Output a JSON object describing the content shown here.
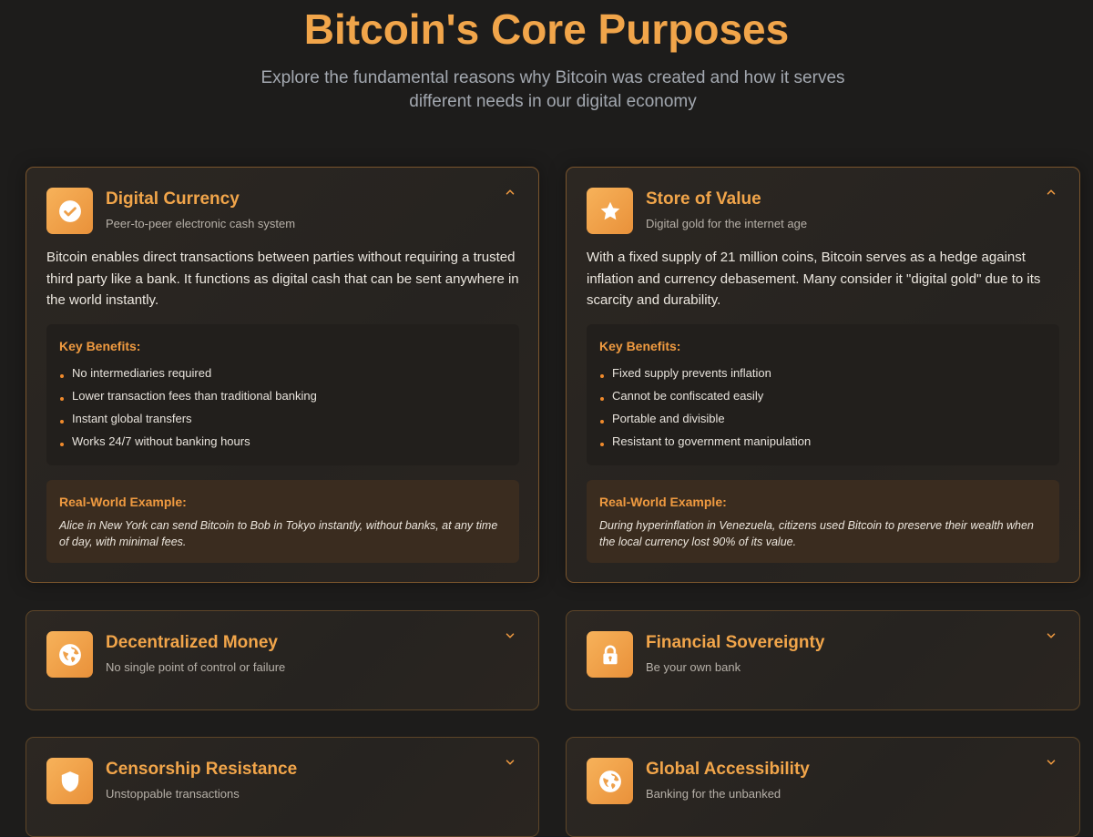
{
  "header": {
    "title": "Bitcoin's Core Purposes",
    "subtitle": "Explore the fundamental reasons why Bitcoin was created and how it serves different needs in our digital economy"
  },
  "colors": {
    "accent": "#f1a54a",
    "background": "#1d1c1b",
    "bullet": "#f08a2c"
  },
  "cards": [
    {
      "title": "Digital Currency",
      "tagline": "Peer-to-peer electronic cash system",
      "icon": "check-circle-icon",
      "expanded": true,
      "description": "Bitcoin enables direct transactions between parties without requiring a trusted third party like a bank. It functions as digital cash that can be sent anywhere in the world instantly.",
      "benefits_label": "Key Benefits:",
      "benefits": [
        "No intermediaries required",
        "Lower transaction fees than traditional banking",
        "Instant global transfers",
        "Works 24/7 without banking hours"
      ],
      "example_label": "Real-World Example:",
      "example": "Alice in New York can send Bitcoin to Bob in Tokyo instantly, without banks, at any time of day, with minimal fees."
    },
    {
      "title": "Store of Value",
      "tagline": "Digital gold for the internet age",
      "icon": "star-icon",
      "expanded": true,
      "description": "With a fixed supply of 21 million coins, Bitcoin serves as a hedge against inflation and currency debasement. Many consider it \"digital gold\" due to its scarcity and durability.",
      "benefits_label": "Key Benefits:",
      "benefits": [
        "Fixed supply prevents inflation",
        "Cannot be confiscated easily",
        "Portable and divisible",
        "Resistant to government manipulation"
      ],
      "example_label": "Real-World Example:",
      "example": "During hyperinflation in Venezuela, citizens used Bitcoin to preserve their wealth when the local currency lost 90% of its value."
    },
    {
      "title": "Decentralized Money",
      "tagline": "No single point of control or failure",
      "icon": "globe-icon",
      "expanded": false
    },
    {
      "title": "Financial Sovereignty",
      "tagline": "Be your own bank",
      "icon": "lock-icon",
      "expanded": false
    },
    {
      "title": "Censorship Resistance",
      "tagline": "Unstoppable transactions",
      "icon": "shield-icon",
      "expanded": false
    },
    {
      "title": "Global Accessibility",
      "tagline": "Banking for the unbanked",
      "icon": "globe-icon",
      "expanded": false
    }
  ]
}
